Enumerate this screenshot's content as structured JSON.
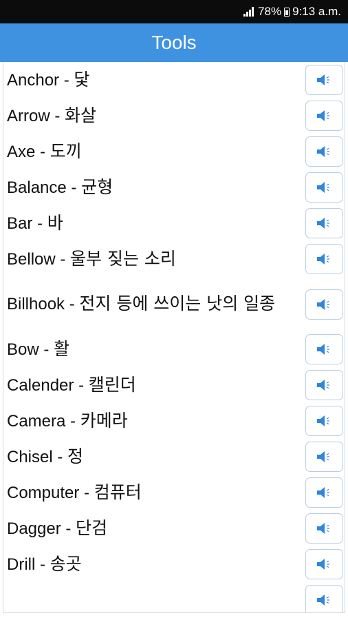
{
  "status_bar": {
    "battery": "78%",
    "time": "9:13 a.m."
  },
  "header": {
    "title": "Tools"
  },
  "colors": {
    "header": "#3e92e0",
    "icon": "#2e86de"
  },
  "items": [
    {
      "en": "Anchor",
      "ko": "닻"
    },
    {
      "en": "Arrow",
      "ko": "화살"
    },
    {
      "en": "Axe",
      "ko": "도끼"
    },
    {
      "en": "Balance",
      "ko": "균형"
    },
    {
      "en": "Bar",
      "ko": "바"
    },
    {
      "en": "Bellow",
      "ko": "울부 짖는 소리"
    },
    {
      "en": "Billhook",
      "ko": "전지 등에 쓰이는 낫의 일종"
    },
    {
      "en": "Bow",
      "ko": "활"
    },
    {
      "en": "Calender",
      "ko": "캘린더"
    },
    {
      "en": "Camera",
      "ko": "카메라"
    },
    {
      "en": "Chisel",
      "ko": "정"
    },
    {
      "en": "Computer",
      "ko": "컴퓨터"
    },
    {
      "en": "Dagger",
      "ko": "단검"
    },
    {
      "en": "Drill",
      "ko": "송곳"
    },
    {
      "en": "",
      "ko": ""
    }
  ],
  "speaker_icon": "speaker-icon"
}
